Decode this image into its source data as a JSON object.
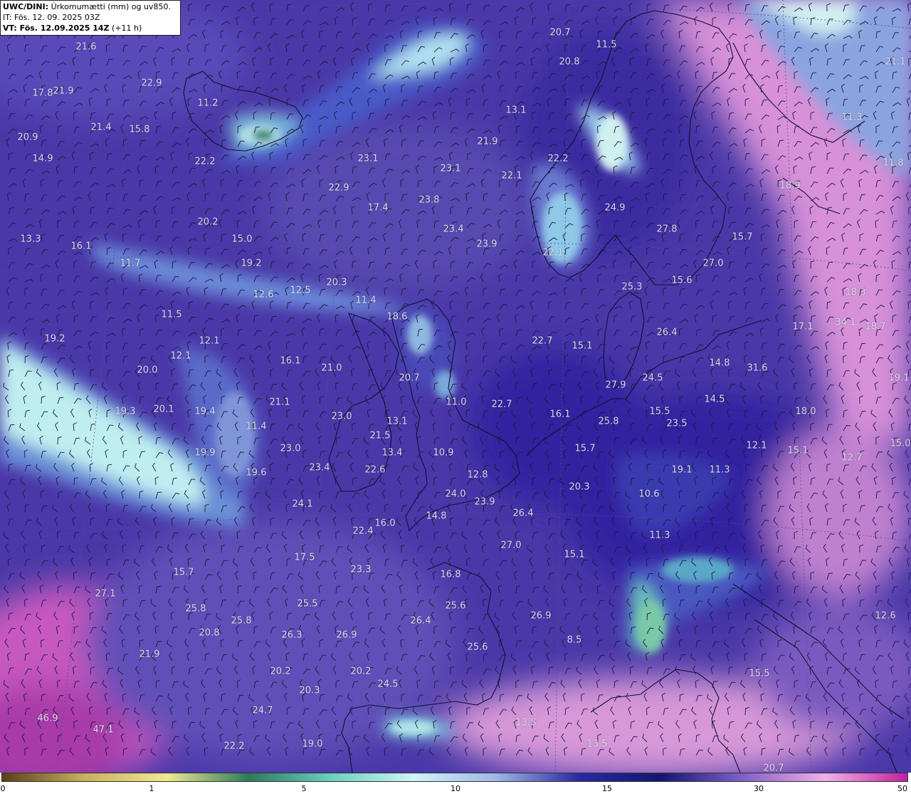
{
  "header": {
    "model": "UWC/DINI:",
    "product": "Úrkomumætti (mm) og uv850.",
    "it_line": "IT: Fös. 12. 09. 2025 03Z",
    "vt_prefix": "VT: Fös. 12.09.2025 14Z",
    "vt_suffix": "(+11 h)"
  },
  "colorbar": {
    "ticks": [
      "0",
      "1",
      "5",
      "10",
      "15",
      "30",
      "50"
    ],
    "colors": [
      "#5a3e1a",
      "#c8b060",
      "#f0e890",
      "#2c7a5c",
      "#6ad0c0",
      "#d0f4f4",
      "#9fb6e8",
      "#2a2aa0",
      "#151570",
      "#8060c8",
      "#f0b0e8",
      "#c020a0"
    ]
  },
  "values": [
    "21.6",
    "17.8",
    "21.9",
    "22.9",
    "11.2",
    "20.7",
    "11.5",
    "20.8",
    "21.1",
    "20.9",
    "21.4",
    "15.8",
    "13.1",
    "14.9",
    "22.2",
    "23.1",
    "23.1",
    "21.9",
    "22.1",
    "22.2",
    "11.3",
    "11.8",
    "22.9",
    "17.4",
    "23.8",
    "24.9",
    "18.9",
    "13.3",
    "16.1",
    "20.2",
    "15.0",
    "23.4",
    "27.8",
    "15.7",
    "23.9",
    "19.2",
    "22.1",
    "27.0",
    "11.7",
    "20.3",
    "15.6",
    "12.6",
    "12.5",
    "11.4",
    "25.3",
    "18.3",
    "11.5",
    "18.6",
    "26.4",
    "17.1",
    "34.1",
    "18.7",
    "19.2",
    "12.1",
    "12.1",
    "22.7",
    "15.1",
    "16.1",
    "21.0",
    "20.0",
    "20.7",
    "31.6",
    "14.8",
    "27.9",
    "24.5",
    "19.1",
    "20.1",
    "19.3",
    "19.4",
    "21.1",
    "23.0",
    "11.0",
    "22.7",
    "16.1",
    "14.5",
    "15.5",
    "25.8",
    "23.5",
    "18.0",
    "13.1",
    "21.5",
    "11.4",
    "12.1",
    "15.1",
    "15.0",
    "19.9",
    "23.0",
    "13.4",
    "10.9",
    "15.7",
    "12.7",
    "19.1",
    "11.3",
    "22.6",
    "19.6",
    "23.4",
    "12.8",
    "20.3",
    "10.6",
    "24.1",
    "24.0",
    "23.9",
    "16.0",
    "14.8",
    "26.4",
    "22.4",
    "11.3",
    "27.0",
    "17.5",
    "15.7",
    "15.1",
    "23.3",
    "16.8",
    "27.1",
    "25.5",
    "25.6",
    "25.8",
    "26.9",
    "25.8",
    "20.8",
    "26.3",
    "26.9",
    "26.4",
    "12.6",
    "8.5",
    "21.9",
    "25.6",
    "20.2",
    "20.2",
    "15.5",
    "24.5",
    "20.3",
    "24.7",
    "46.9",
    "47.1",
    "13.8",
    "13.5",
    "22.2",
    "19.0",
    "20.7"
  ]
}
